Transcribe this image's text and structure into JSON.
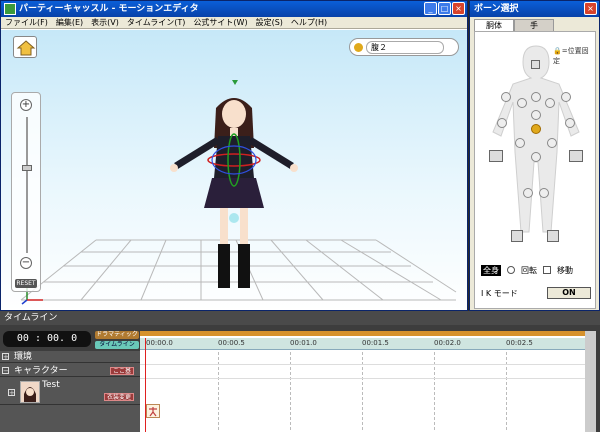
{
  "editor": {
    "title": "パーティーキャッスル - モーションエディタ",
    "menu": [
      "ファイル(F)",
      "編集(E)",
      "表示(V)",
      "タイムライン(T)",
      "公式サイト(W)",
      "設定(S)",
      "ヘルプ(H)"
    ],
    "window_buttons": {
      "minimize": "_",
      "maximize": "□",
      "close": "×"
    },
    "zoom_plus": "+",
    "zoom_minus": "−",
    "reset_label": "RESET",
    "selected_bone": "腹２"
  },
  "bone_panel": {
    "title": "ボーン選択",
    "tabs": [
      "胴体",
      "手"
    ],
    "position_lock_label": "🔒=位置固定",
    "mode_all": "全身",
    "mode_rotate": "回転",
    "mode_move": "移動",
    "ik_label": "I K モード",
    "ik_button": "ON"
  },
  "timeline": {
    "title": "タイムライン",
    "time": "00 : 00. 0",
    "tags": [
      "ドラマティック",
      "タイムライン"
    ],
    "rows": [
      {
        "label": "環境",
        "tag": ""
      },
      {
        "label": "キャラクター",
        "tag": "ここ基"
      },
      {
        "label": "Test",
        "tag": "衣装変更"
      }
    ],
    "ruler_labels": [
      "00:00.0",
      "00:00.5",
      "00:01.0",
      "00:01.5",
      "00:02.0",
      "00:02.5"
    ]
  },
  "colors": {
    "titlebar": "#0a5fd8",
    "timeline_bg": "#3d3d3d",
    "keyframe_bar": "#d6922c",
    "playhead": "#e02020"
  }
}
